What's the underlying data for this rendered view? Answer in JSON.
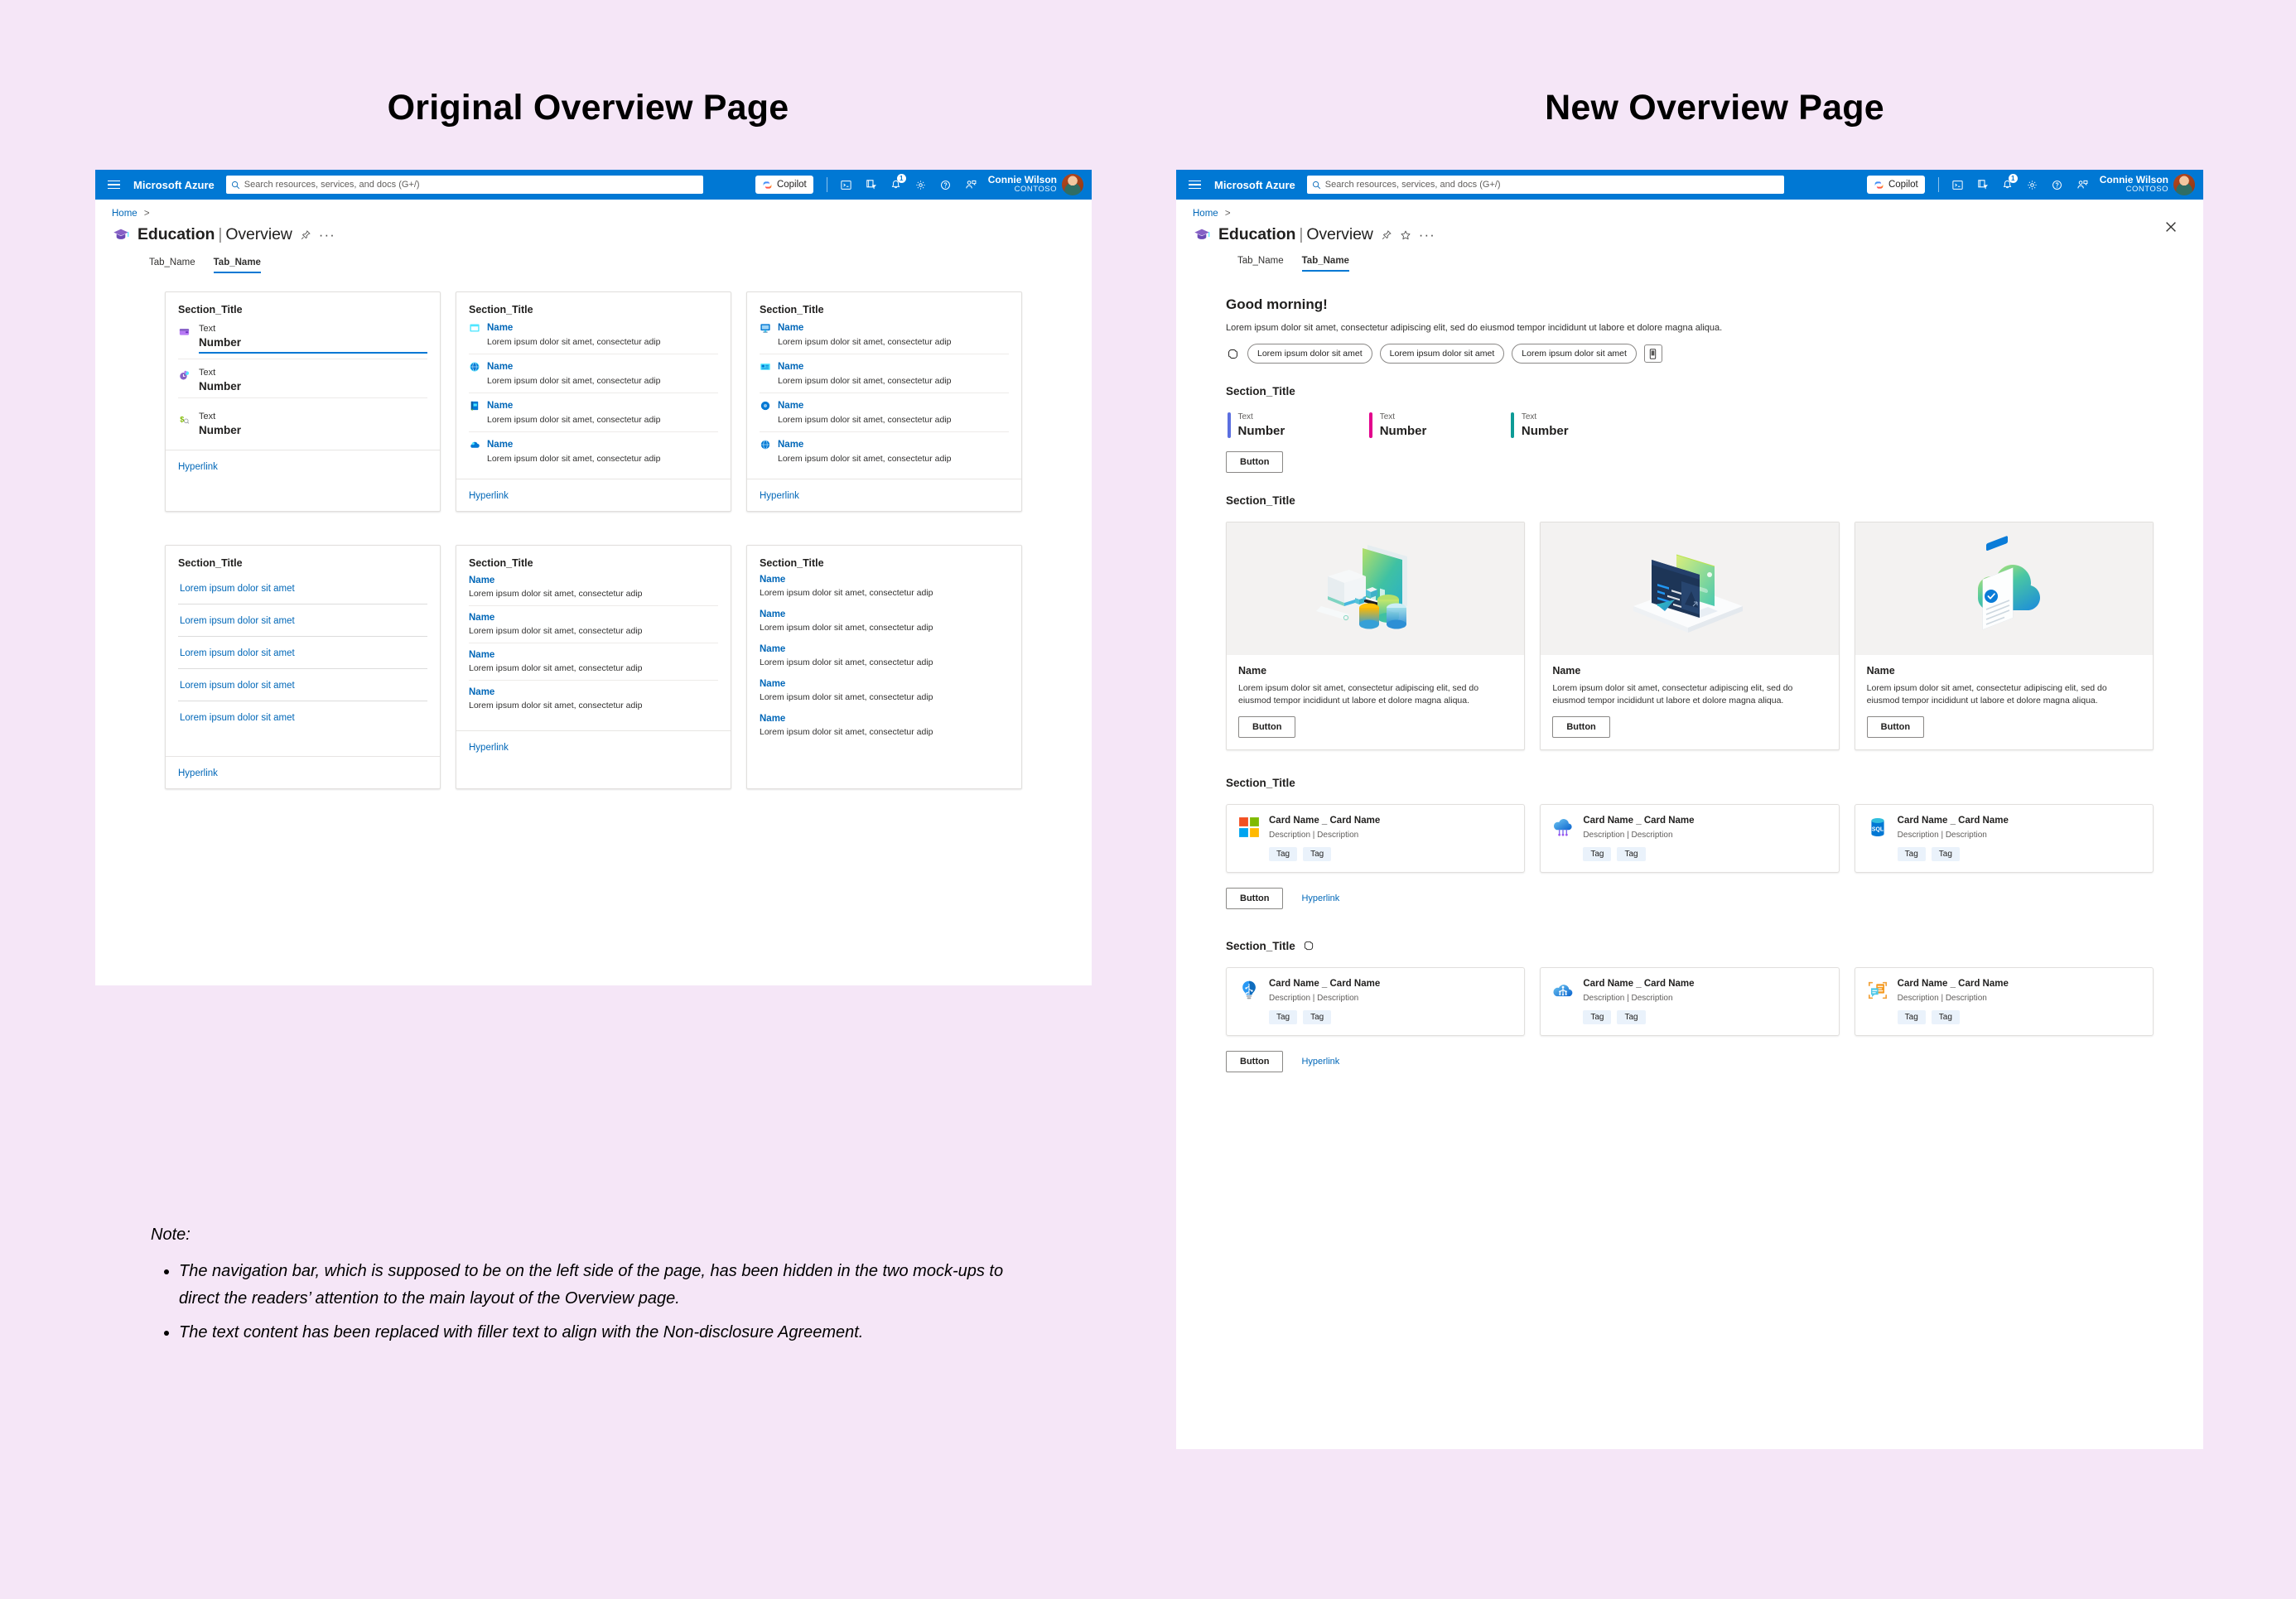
{
  "titles": {
    "left": "Original Overview Page",
    "right": "New Overview Page"
  },
  "topbar": {
    "brand": "Microsoft Azure",
    "search_placeholder": "Search resources, services, and docs (G+/)",
    "copilot_label": "Copilot",
    "notification_badge": "1",
    "user_name": "Connie Wilson",
    "user_org": "CONTOSO",
    "icons": [
      "cloud-shell-icon",
      "directories-filter-icon",
      "notifications-bell-icon",
      "settings-gear-icon",
      "help-question-icon",
      "feedback-person-icon"
    ]
  },
  "header": {
    "breadcrumb": "Home",
    "breadcrumb_sep": ">",
    "title": "Education",
    "divider": "|",
    "subtitle": "Overview",
    "actions_left": [
      "pin-icon",
      "more-dots-icon"
    ],
    "actions_right": [
      "pin-icon",
      "favorite-star-icon",
      "more-dots-icon"
    ],
    "close_label": "close-icon"
  },
  "tabs": [
    {
      "label": "Tab_Name",
      "active": false
    },
    {
      "label": "Tab_Name",
      "active": true
    }
  ],
  "left_page": {
    "cards_row1": [
      {
        "title": "Section_Title",
        "type": "metrics",
        "metrics": [
          {
            "icon": "wallet-icon",
            "label": "Text",
            "value": "Number",
            "underline": true
          },
          {
            "icon": "clock-budget-icon",
            "label": "Text",
            "value": "Number",
            "underline": false
          },
          {
            "icon": "cost-analysis-icon",
            "label": "Text",
            "value": "Number",
            "underline": false
          }
        ]
      },
      {
        "title": "Section_Title",
        "type": "named-list",
        "footer_link": "Hyperlink",
        "items": [
          {
            "icon": "window-app-icon",
            "name": "Name",
            "desc": "Lorem ipsum dolor sit amet, consectetur adip"
          },
          {
            "icon": "globe-network-icon",
            "name": "Name",
            "desc": "Lorem ipsum dolor sit amet, consectetur adip"
          },
          {
            "icon": "learn-book-icon",
            "name": "Name",
            "desc": "Lorem ipsum dolor sit amet, consectetur adip"
          },
          {
            "icon": "cloud-gear-icon",
            "name": "Name",
            "desc": "Lorem ipsum dolor sit amet, consectetur adip"
          }
        ]
      },
      {
        "title": "Section_Title",
        "type": "named-list",
        "footer_link": "Hyperlink",
        "items": [
          {
            "icon": "monitor-icon",
            "name": "Name",
            "desc": "Lorem ipsum dolor sit amet, consectetur adip"
          },
          {
            "icon": "card-icon",
            "name": "Name",
            "desc": "Lorem ipsum dolor sit amet, consectetur adip"
          },
          {
            "icon": "sphere-icon",
            "name": "Name",
            "desc": "Lorem ipsum dolor sit amet, consectetur adip"
          },
          {
            "icon": "globe-network-icon",
            "name": "Name",
            "desc": "Lorem ipsum dolor sit amet, consectetur adip"
          }
        ]
      }
    ],
    "cards_row2": [
      {
        "title": "Section_Title",
        "type": "link-list",
        "footer_link": "Hyperlink",
        "links": [
          "Lorem ipsum dolor sit amet",
          "Lorem ipsum dolor sit amet",
          "Lorem ipsum dolor sit amet",
          "Lorem ipsum dolor sit amet",
          "Lorem ipsum dolor sit amet"
        ]
      },
      {
        "title": "Section_Title",
        "type": "named-list-noicon",
        "footer_link": "Hyperlink",
        "items": [
          {
            "name": "Name",
            "desc": "Lorem ipsum dolor sit amet, consectetur adip"
          },
          {
            "name": "Name",
            "desc": "Lorem ipsum dolor sit amet, consectetur adip"
          },
          {
            "name": "Name",
            "desc": "Lorem ipsum dolor sit amet, consectetur adip"
          },
          {
            "name": "Name",
            "desc": "Lorem ipsum dolor sit amet, consectetur adip"
          }
        ]
      },
      {
        "title": "Section_Title",
        "type": "named-list-plain",
        "items": [
          {
            "name": "Name",
            "desc": "Lorem ipsum dolor sit amet, consectetur adip"
          },
          {
            "name": "Name",
            "desc": "Lorem ipsum dolor sit amet, consectetur adip"
          },
          {
            "name": "Name",
            "desc": "Lorem ipsum dolor sit amet, consectetur adip"
          },
          {
            "name": "Name",
            "desc": "Lorem ipsum dolor sit amet, consectetur adip"
          },
          {
            "name": "Name",
            "desc": "Lorem ipsum dolor sit amet, consectetur adip"
          }
        ]
      }
    ]
  },
  "right_page": {
    "greeting": "Good morning!",
    "greeting_desc": "Lorem ipsum dolor sit amet, consectetur adipiscing elit, sed do eiusmod tempor incididunt ut labore et dolore magna aliqua.",
    "copilot_chip_icon": "copilot-sparkle-icon",
    "chips": [
      "Lorem ipsum dolor sit amet",
      "Lorem ipsum dolor sit amet",
      "Lorem ipsum dolor sit amet"
    ],
    "chip_square_icon": "mobile-device-icon",
    "metrics_section": {
      "title": "Section_Title",
      "button": "Button",
      "metrics": [
        {
          "label": "Text",
          "value": "Number",
          "color": "#5B6FE0"
        },
        {
          "label": "Text",
          "value": "Number",
          "color": "#E3008C"
        },
        {
          "label": "Text",
          "value": "Number",
          "color": "#0E9B96"
        }
      ]
    },
    "promo_section": {
      "title": "Section_Title",
      "cards": [
        {
          "illustration": "monitor-chart-illustration",
          "name": "Name",
          "desc": "Lorem ipsum dolor sit amet, consectetur adipiscing elit, sed do eiusmod tempor incididunt ut labore et dolore magna aliqua.",
          "button": "Button"
        },
        {
          "illustration": "laptop-code-illustration",
          "name": "Name",
          "desc": "Lorem ipsum dolor sit amet, consectetur adipiscing elit, sed do eiusmod tempor incididunt ut labore et dolore magna aliqua.",
          "button": "Button"
        },
        {
          "illustration": "cloud-document-illustration",
          "name": "Name",
          "desc": "Lorem ipsum dolor sit amet, consectetur adipiscing elit, sed do eiusmod tempor incididunt ut labore et dolore magna aliqua.",
          "button": "Button"
        }
      ]
    },
    "tiles_section_1": {
      "title": "Section_Title",
      "button": "Button",
      "link": "Hyperlink",
      "tiles": [
        {
          "icon": "microsoft-logo-icon",
          "name": "Card Name _ Card Name",
          "desc": "Description | Description",
          "tags": [
            "Tag",
            "Tag"
          ]
        },
        {
          "icon": "azure-cloud-rain-icon",
          "name": "Card Name _ Card Name",
          "desc": "Description | Description",
          "tags": [
            "Tag",
            "Tag"
          ]
        },
        {
          "icon": "sql-database-icon",
          "name": "Card Name _ Card Name",
          "desc": "Description | Description",
          "tags": [
            "Tag",
            "Tag"
          ]
        }
      ]
    },
    "tiles_section_2": {
      "title": "Section_Title",
      "title_icon": "copilot-sparkle-icon",
      "button": "Button",
      "link": "Hyperlink",
      "tiles": [
        {
          "icon": "ai-lightbulb-icon",
          "name": "Card Name _ Card Name",
          "desc": "Description | Description",
          "tags": [
            "Tag",
            "Tag"
          ]
        },
        {
          "icon": "ai-cloud-nodes-icon",
          "name": "Card Name _ Card Name",
          "desc": "Description | Description",
          "tags": [
            "Tag",
            "Tag"
          ]
        },
        {
          "icon": "chat-translate-icon",
          "name": "Card Name _ Card Name",
          "desc": "Description | Description",
          "tags": [
            "Tag",
            "Tag"
          ]
        }
      ]
    }
  },
  "note": {
    "label": "Note:",
    "items": [
      "The navigation bar, which is supposed to be on the left side of the page, has been hidden in the two mock-ups to direct the readers’ attention to the main layout of the Overview page.",
      "The text content has been replaced with filler text to align with the Non-disclosure Agreement."
    ]
  }
}
